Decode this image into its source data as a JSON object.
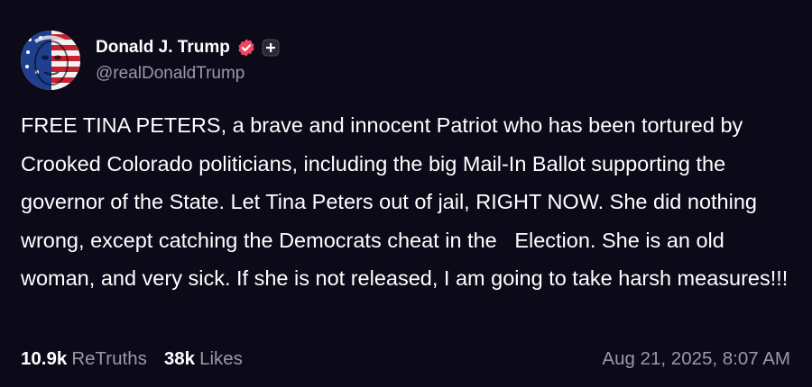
{
  "author": {
    "display_name": "Donald J. Trump",
    "handle": "@realDonaldTrump",
    "avatar_icon": "patriotic-face-avatar",
    "verified_icon": "verified-badge-icon",
    "verified_color": "#ef4560",
    "plus_icon": "plus-icon"
  },
  "post": {
    "text": "FREE TINA PETERS, a brave and innocent Patriot who has been tortured by Crooked Colorado politicians, including the big Mail-In Ballot supporting the governor of the State. Let Tina Peters out of jail, RIGHT NOW. She did nothing wrong, except catching the Democrats cheat in the   Election. She is an old woman, and very sick. If she is not released, I am going to take harsh measures!!!"
  },
  "stats": {
    "retruths_count": "10.9k",
    "retruths_label": "ReTruths",
    "likes_count": "38k",
    "likes_label": "Likes"
  },
  "timestamp": "Aug 21, 2025, 8:07 AM",
  "colors": {
    "background": "#0c0918",
    "text_primary": "#ffffff",
    "text_secondary": "#9b99a8"
  }
}
